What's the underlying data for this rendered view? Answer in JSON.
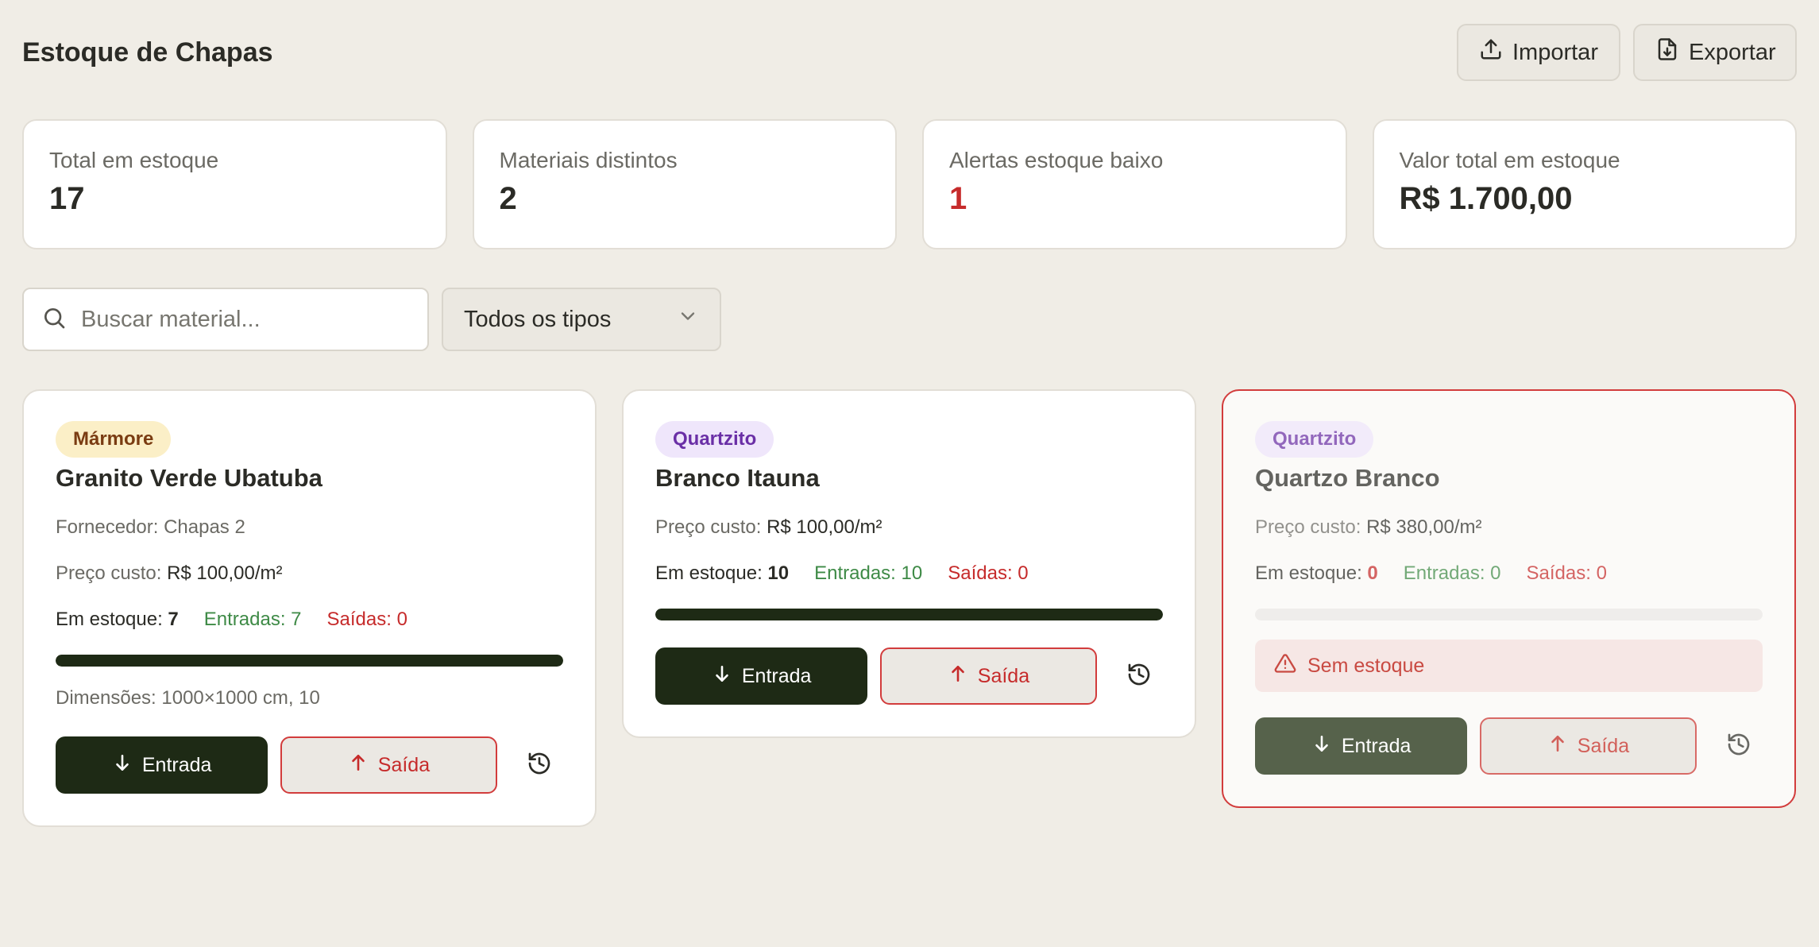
{
  "header": {
    "title": "Estoque de Chapas",
    "import_label": "Importar",
    "export_label": "Exportar"
  },
  "stats": [
    {
      "label": "Total em estoque",
      "value": "17"
    },
    {
      "label": "Materiais distintos",
      "value": "2"
    },
    {
      "label": "Alertas estoque baixo",
      "value": "1"
    },
    {
      "label": "Valor total em estoque",
      "value": "R$ 1.700,00"
    }
  ],
  "filters": {
    "search_placeholder": "Buscar material...",
    "type_selected": "Todos os tipos"
  },
  "cards": [
    {
      "badge": "Mármore",
      "name": "Granito Verde Ubatuba",
      "supplier_label": "Fornecedor:",
      "supplier": "Chapas 2",
      "price_label": "Preço custo:",
      "price": "R$ 100,00/m²",
      "stock_label": "Em estoque:",
      "stock": "7",
      "entries": "Entradas: 7",
      "exits": "Saídas: 0",
      "stock_fill_fraction": 1.0,
      "dimensions": "Dimensões: 1000×1000 cm, 10",
      "in_label": "Entrada",
      "out_label": "Saída"
    },
    {
      "badge": "Quartzito",
      "name": "Branco Itauna",
      "price_label": "Preço custo:",
      "price": "R$ 100,00/m²",
      "stock_label": "Em estoque:",
      "stock": "10",
      "entries": "Entradas: 10",
      "exits": "Saídas: 0",
      "stock_fill_fraction": 1.0,
      "in_label": "Entrada",
      "out_label": "Saída"
    },
    {
      "badge": "Quartzito",
      "name": "Quartzo Branco",
      "price_label": "Preço custo:",
      "price": "R$ 380,00/m²",
      "stock_label": "Em estoque:",
      "stock": "0",
      "entries": "Entradas: 0",
      "exits": "Saídas: 0",
      "stock_fill_fraction": 0.0,
      "alert": "Sem estoque",
      "in_label": "Entrada",
      "out_label": "Saída"
    }
  ],
  "colors": {
    "background": "#f0ede6",
    "primary_dark": "#1e2a15",
    "danger": "#c62b2b",
    "success": "#3e8a46"
  }
}
